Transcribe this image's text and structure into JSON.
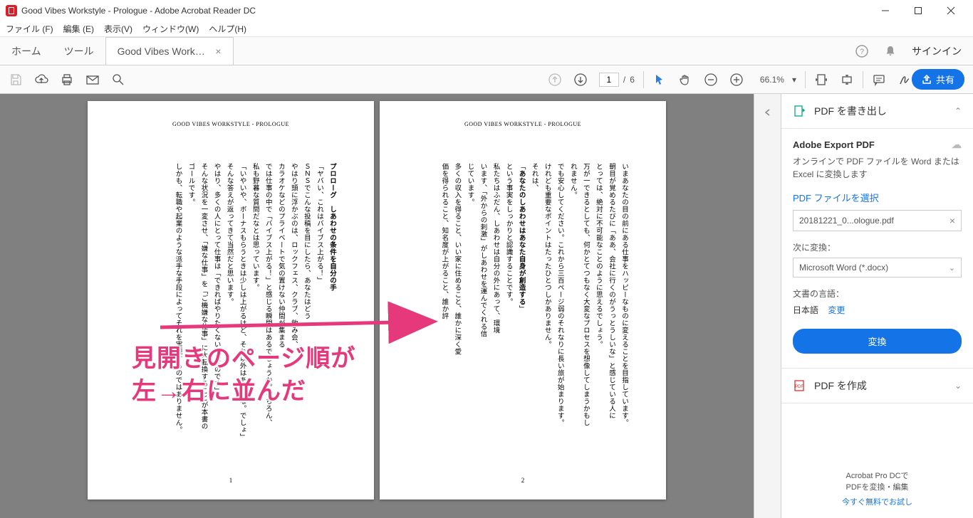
{
  "window": {
    "title": "Good Vibes Workstyle - Prologue - Adobe Acrobat Reader DC"
  },
  "menu": {
    "file": "ファイル (F)",
    "edit": "編集 (E)",
    "view": "表示(V)",
    "window": "ウィンドウ(W)",
    "help": "ヘルプ(H)"
  },
  "tabs": {
    "home": "ホーム",
    "tools": "ツール",
    "doc": "Good Vibes Workst...",
    "signin": "サインイン"
  },
  "toolbar": {
    "page_current": "1",
    "page_sep": "/",
    "page_total": "6",
    "zoom": "66.1%",
    "share": "共有"
  },
  "rpanel": {
    "export_header": "PDF を書き出し",
    "export_title": "Adobe Export PDF",
    "export_desc": "オンラインで PDF ファイルを Word または Excel に変換します",
    "select_file": "PDF ファイルを選択",
    "filename": "20181221_0...ologue.pdf",
    "convert_to_label": "次に変換：",
    "convert_to_value": "Microsoft Word (*.docx)",
    "lang_label": "文書の言語：",
    "lang_value": "日本語",
    "lang_change": "変更",
    "convert_btn": "変換",
    "create_header": "PDF を作成",
    "footer_line1": "Acrobat Pro DCで",
    "footer_line2": "PDFを変換・編集",
    "footer_link": "今すぐ無料でお試し"
  },
  "annotation": {
    "line1": "見開きのページ順が",
    "line2": "左→右に並んだ"
  },
  "pages": {
    "header": "GOOD VIBES WORKSTYLE - PROLOGUE",
    "left_num": "1",
    "right_num": "2",
    "left_body": "プロローグ　しあわせの条件を自分の手\n「ヤバい、これはバイブス上がる！」\nＳＮＳでこんな投稿を目にしたら、あなたはどう\nやはり頭に浮かぶのは、ロックフェス、クラブ、飲み会、\nカラオケなどのプライベートで気の置けない仲間が集まる\nでは仕事の中で「バイブス上がる！」と感じる瞬間はあるでしょうか。もちろん、\n私も野暮な質問だなとは思っています。\n「いやいや、ボーナスもらうときは少しは上がるけど、それ以外はあり得な。でしょ」\nそんな答えが返ってきて当然だと思います。\nやはり、多くの人にとって仕事は「できればやりたくない」「なのです」\nそんな状況を一変させ、「嫌な仕事」を「ご機嫌な仕事」に大転換することが本書の\nゴールです。\nしかも、転職や起業のような派手な手段によってそれを実現するのではありません。",
    "right_body": "いまあなたの目の前にある仕事をハッピーなものに変えることを目指しています。\n朝目が覚めるたびに「ああ、会社に行くのがうっとうしいな」と感じている人に\nとっては、絶対に不可能なことのように思えるでしょう。\n万が一できるとしても、何かとてつもなく大変なプロセスを想像してしまうかもし\nれません。\nでも安心してください。これから三百ページ弱のそれなりに長い旅が始まります。\nけれども重要なポイントはたったひとつしかありません。\nそれは、\n「あなたのしあわせはあなた自身が創造する」\nという事実をしっかりと認識することです。\n私たちはふだん、しあわせは自分の外にあって、環境\nいます、「外からの刺激」がしあわせを運んでくれる信\nじています。\n多くの収入を得ること、いい家に住めること、誰かに深く愛\n価を得られること、知名度が上がること、誰か評"
  }
}
